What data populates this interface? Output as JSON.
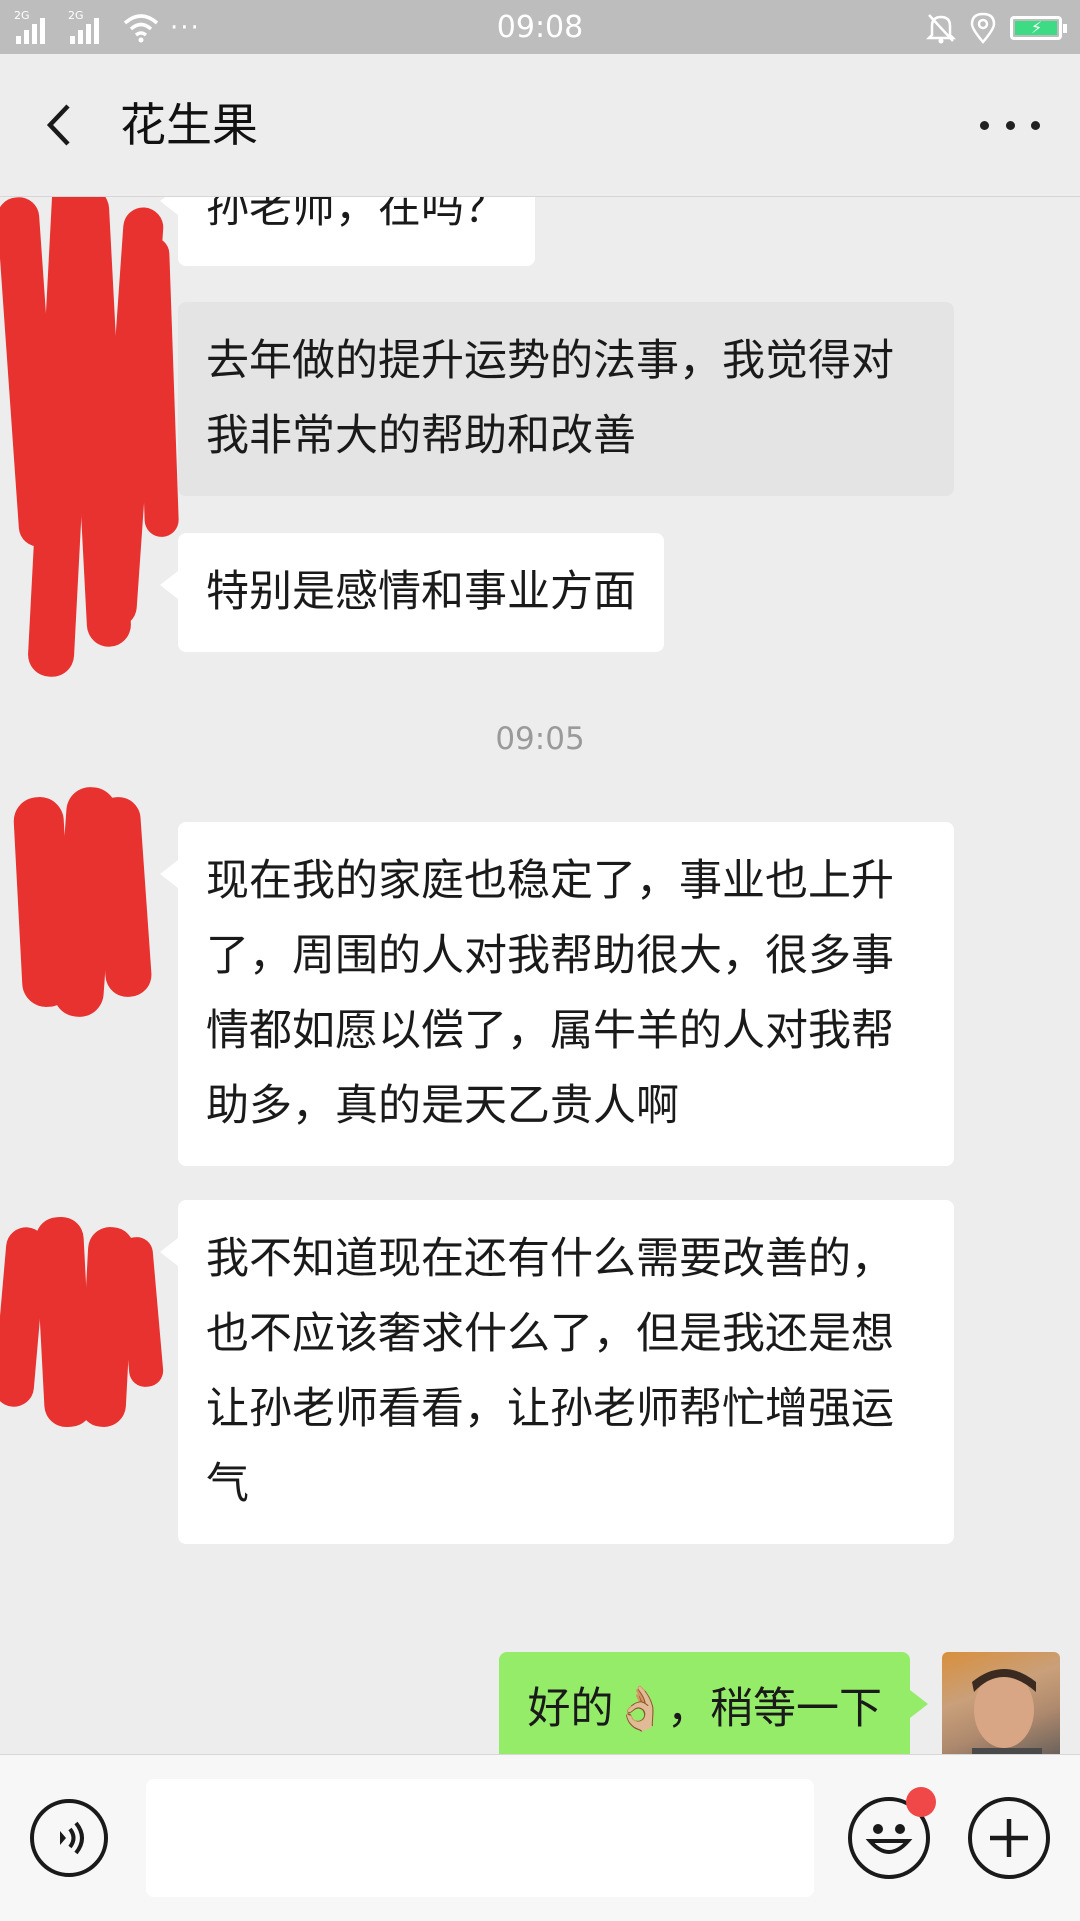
{
  "status_bar": {
    "sim1_label": "2G",
    "sim2_label": "2G",
    "more_dots": "···",
    "time": "09:08",
    "icons": [
      "signal-icon",
      "wifi-icon",
      "mute-bell-icon",
      "location-icon",
      "battery-charging-icon"
    ]
  },
  "header": {
    "title": "花生果",
    "back_icon": "chevron-left-icon",
    "more_icon": "more-dots-icon"
  },
  "messages": [
    {
      "side": "left",
      "text": "孙老师，在吗？"
    },
    {
      "side": "left",
      "text": "去年做的提升运势的法事，我觉得对我非常大的帮助和改善",
      "selected": true
    },
    {
      "side": "left",
      "text": "特别是感情和事业方面"
    },
    {
      "timestamp": "09:05"
    },
    {
      "side": "left",
      "text": "现在我的家庭也稳定了，事业也上升了，周围的人对我帮助很大，很多事情都如愿以偿了，属牛羊的人对我帮助多，真的是天乙贵人啊"
    },
    {
      "side": "left",
      "text": "我不知道现在还有什么需要改善的，也不应该奢求什么了，但是我还是想让孙老师看看，让孙老师帮忙增强运气"
    },
    {
      "side": "right",
      "text": "好的👌🏼，稍等一下"
    }
  ],
  "input_bar": {
    "voice_icon": "voice-icon",
    "emoji_icon": "emoji-icon",
    "plus_icon": "plus-icon",
    "input_value": ""
  },
  "colors": {
    "chat_bg": "#ededed",
    "bubble_left": "#ffffff",
    "bubble_selected": "#e4e4e4",
    "bubble_mine": "#95ec69",
    "redaction": "#e8322f"
  }
}
